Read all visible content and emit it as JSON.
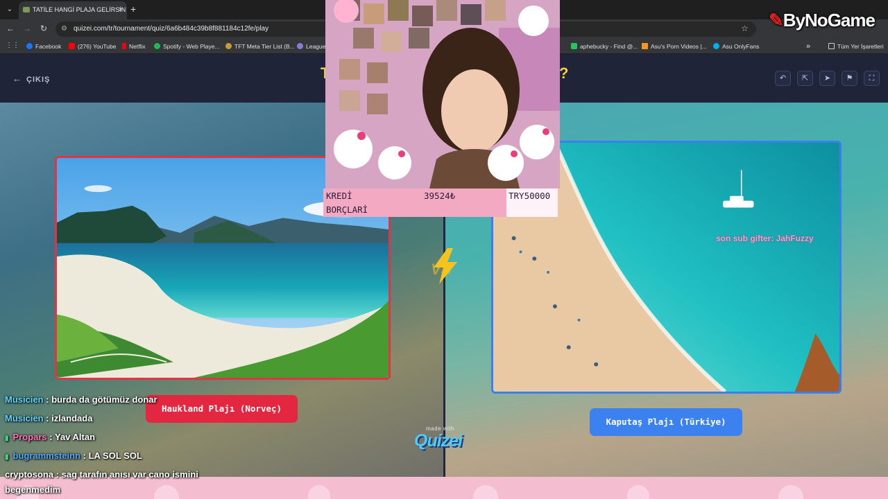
{
  "browser": {
    "tab_title": "TATİLE HANGİ PLAJA GELİRSİN",
    "new_tab": "+",
    "url": "quizei.com/tr/tournament/quiz/6a6b484c39b8f881184c12fe/play",
    "bookmarks": [
      {
        "label": "Facebook",
        "color": "#1877f2"
      },
      {
        "label": "(276) YouTube",
        "color": "#ff0000"
      },
      {
        "label": "Netflix",
        "color": "#e50914"
      },
      {
        "label": "Spotify - Web Playe...",
        "color": "#1db954"
      },
      {
        "label": "TFT Meta Tier List (B...",
        "color": "#c89b3c"
      },
      {
        "label": "League",
        "color": "#8a7bd0"
      },
      {
        "label": "aphebucky - Find @...",
        "color": "#22c55e"
      },
      {
        "label": "Asu's Porn Videos |...",
        "color": "#f7971e"
      },
      {
        "label": "Asu OnlyFans",
        "color": "#00aff0"
      }
    ],
    "more_bookmarks": "»",
    "all_bookmarks": "Tüm Yer İşaretleri"
  },
  "overlay": {
    "logo": "ByNoGame",
    "sub_gifter": "son sub gifter: JahFuzzy",
    "cam_label": {
      "col1_line1": "KREDİ",
      "col1_line2": "BORÇLARİ",
      "col2": "39524₺",
      "col3": "TRY50000"
    }
  },
  "app": {
    "exit_label": "ÇIKIŞ",
    "title_left_glyph": "T",
    "title_right_glyph": "?",
    "left_option": "Haukland Plajı (Norveç)",
    "right_option": "Kaputaş Plajı (Türkiye)",
    "vs_label": "VS",
    "made_with": "made with",
    "brand": "Quizei"
  },
  "chat": [
    {
      "user": "Musicien",
      "msg": ": burda da götümüz donar",
      "style": "u1",
      "dot": false
    },
    {
      "user": "Musicien",
      "msg": ": izlandada",
      "style": "u1",
      "dot": false
    },
    {
      "user": "Propars",
      "msg": ": Yav Altan",
      "style": "u2",
      "dot": true
    },
    {
      "user": "bugrammsteinn",
      "msg": ": LA SOL SOL",
      "style": "u3",
      "dot": true
    },
    {
      "user": "cryptosona",
      "msg": ": sag tarafın anısı var cano ismini",
      "style": "none",
      "dot": false
    },
    {
      "user": "",
      "msg": "begenmedim",
      "style": "none",
      "dot": false
    }
  ]
}
